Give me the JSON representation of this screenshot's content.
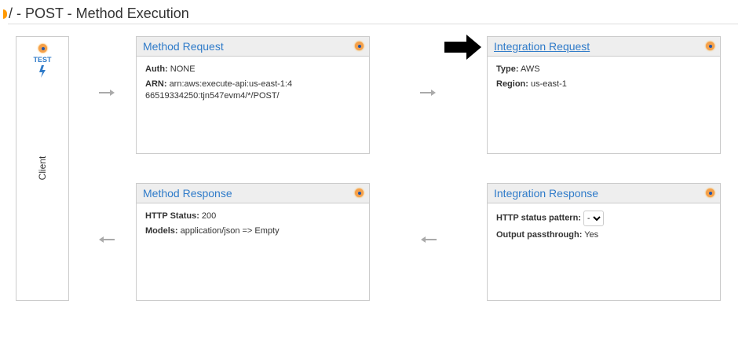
{
  "page": {
    "title": "/ - POST - Method Execution"
  },
  "client": {
    "test_label": "TEST",
    "label": "Client"
  },
  "method_request": {
    "title": "Method Request",
    "auth_label": "Auth:",
    "auth_value": "NONE",
    "arn_label": "ARN:",
    "arn_value": "arn:aws:execute-api:us-east-1:466519334250:tjn547evm4/*/POST/"
  },
  "integration_request": {
    "title": "Integration Request",
    "type_label": "Type:",
    "type_value": "AWS",
    "region_label": "Region:",
    "region_value": "us-east-1"
  },
  "method_response": {
    "title": "Method Response",
    "status_label": "HTTP Status:",
    "status_value": "200",
    "models_label": "Models:",
    "models_value": "application/json => Empty"
  },
  "integration_response": {
    "title": "Integration Response",
    "pattern_label": "HTTP status pattern:",
    "pattern_value": "-",
    "passthrough_label": "Output passthrough:",
    "passthrough_value": "Yes"
  }
}
